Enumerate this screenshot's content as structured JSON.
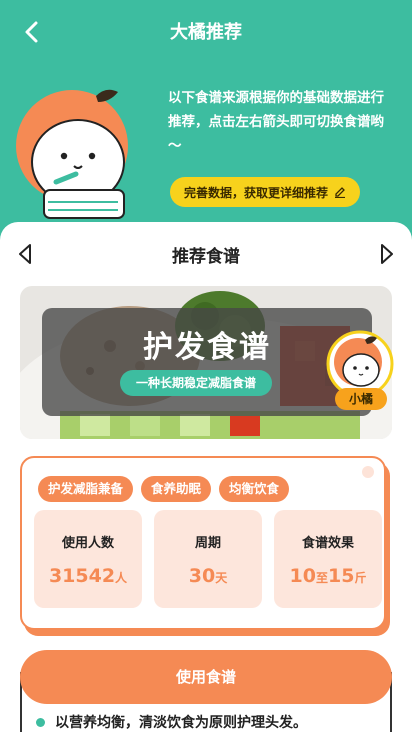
{
  "header": {
    "title": "大橘推荐"
  },
  "intro": {
    "text": "以下食谱来源根据你的基础数据进行推荐，点击左右箭头即可切换食谱哟～",
    "complete_button": "完善数据，获取更详细推荐"
  },
  "card": {
    "title": "推荐食谱",
    "recipe_name": "护发食谱",
    "recipe_tagline": "一种长期稳定减脂食谱",
    "avatar_label": "小橘",
    "tags": [
      "护发减脂兼备",
      "食养助眠",
      "均衡饮食"
    ],
    "stats": [
      {
        "label": "使用人数",
        "value": "31542",
        "unit": "人"
      },
      {
        "label": "周期",
        "value": "30",
        "unit": "天"
      },
      {
        "label": "食谱效果",
        "value_a": "10",
        "mid": "至",
        "value_b": "15",
        "unit": "斤"
      }
    ],
    "use_button": "使用食谱",
    "description": "以营养均衡，清淡饮食为原则护理头发。"
  },
  "colors": {
    "teal": "#3dbda0",
    "orange": "#f58a54",
    "yellow": "#f7d21c"
  }
}
